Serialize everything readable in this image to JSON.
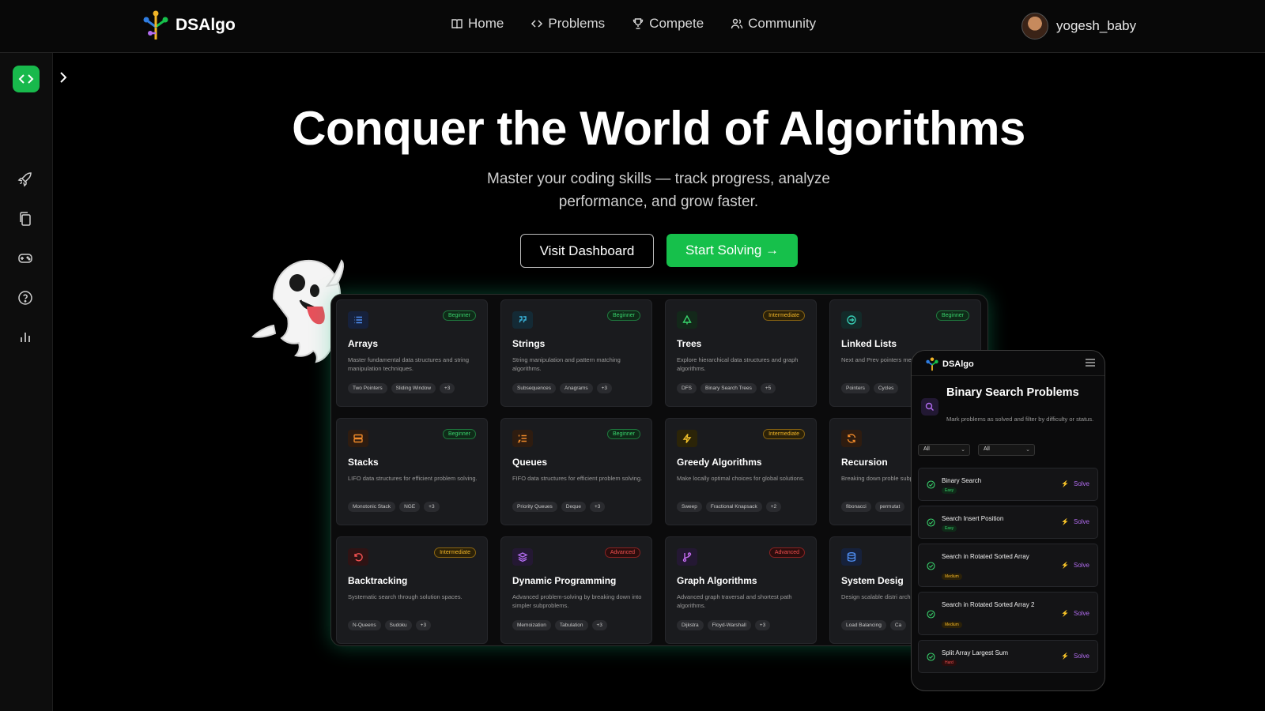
{
  "brand": {
    "name": "DSAlgo"
  },
  "nav": {
    "items": [
      {
        "label": "Home",
        "icon": "book-icon"
      },
      {
        "label": "Problems",
        "icon": "code-icon"
      },
      {
        "label": "Compete",
        "icon": "trophy-icon"
      },
      {
        "label": "Community",
        "icon": "users-icon"
      }
    ]
  },
  "user": {
    "name": "yogesh_baby"
  },
  "sidebar": {
    "icons": [
      "code-icon",
      "chevron-right-icon",
      "rocket-icon",
      "copy-icon",
      "gamepad-icon",
      "help-circle-icon",
      "bar-chart-icon"
    ]
  },
  "hero": {
    "title": "Conquer the World of Algorithms",
    "subtitle": "Master your coding skills — track progress, analyze performance, and grow faster.",
    "dashboard_button": "Visit Dashboard",
    "start_button": "Start Solving →"
  },
  "topics": [
    {
      "title": "Arrays",
      "level": "Beginner",
      "desc": "Master fundamental data structures and string manipulation techniques.",
      "tags": [
        "Two Pointers",
        "Sliding Window",
        "+3"
      ],
      "icon": "list-icon"
    },
    {
      "title": "Strings",
      "level": "Beginner",
      "desc": "String manipulation and pattern matching algorithms.",
      "tags": [
        "Subsequences",
        "Anagrams",
        "+3"
      ],
      "icon": "quote-icon"
    },
    {
      "title": "Trees",
      "level": "Intermediate",
      "desc": "Explore hierarchical data structures and graph algorithms.",
      "tags": [
        "DFS",
        "Binary Search Trees",
        "+5"
      ],
      "icon": "tree-icon"
    },
    {
      "title": "Linked Lists",
      "level": "Beginner",
      "desc": "Next and Prev pointers merging techniques.",
      "tags": [
        "Pointers",
        "Cycles"
      ],
      "icon": "arrow-circle-icon"
    },
    {
      "title": "Stacks",
      "level": "Beginner",
      "desc": "LIFO data structures for efficient problem solving.",
      "tags": [
        "Monotonic Stack",
        "NGE",
        "+3"
      ],
      "icon": "stack-icon"
    },
    {
      "title": "Queues",
      "level": "Beginner",
      "desc": "FIFO data structures for efficient problem solving.",
      "tags": [
        "Priority Queues",
        "Deque",
        "+3"
      ],
      "icon": "list-ordered-icon"
    },
    {
      "title": "Greedy Algorithms",
      "level": "Intermediate",
      "desc": "Make locally optimal choices for global solutions.",
      "tags": [
        "Sweep",
        "Fractional Knapsack",
        "+2"
      ],
      "icon": "zap-icon"
    },
    {
      "title": "Recursion",
      "level": "",
      "desc": "Breaking down proble subproblems.",
      "tags": [
        "fibonacci",
        "permutat"
      ],
      "icon": "refresh-icon"
    },
    {
      "title": "Backtracking",
      "level": "Intermediate",
      "desc": "Systematic search through solution spaces.",
      "tags": [
        "N-Queens",
        "Sudoku",
        "+3"
      ],
      "icon": "undo-icon"
    },
    {
      "title": "Dynamic Programming",
      "level": "Advanced",
      "desc": "Advanced problem-solving by breaking down into simpler subproblems.",
      "tags": [
        "Memoization",
        "Tabulation",
        "+3"
      ],
      "icon": "layers-icon"
    },
    {
      "title": "Graph Algorithms",
      "level": "Advanced",
      "desc": "Advanced graph traversal and shortest path algorithms.",
      "tags": [
        "Dijkstra",
        "Floyd-Warshall",
        "+3"
      ],
      "icon": "git-branch-icon"
    },
    {
      "title": "System Desig",
      "level": "",
      "desc": "Design scalable distri architectures.",
      "tags": [
        "Load Balancing",
        "Ca"
      ],
      "icon": "database-icon"
    }
  ],
  "colors": {
    "accent": "#16c04b",
    "beginner": "#38d26b",
    "intermediate": "#f2b527",
    "advanced": "#f05050",
    "solve": "#b26cf0"
  },
  "phone": {
    "brand": "DSAlgo",
    "title": "Binary Search Problems",
    "desc": "Mark problems as solved and filter by difficulty or status.",
    "filter1": "All",
    "filter2": "All",
    "problems": [
      {
        "name": "Binary Search",
        "difficulty": "Easy",
        "action": "Solve"
      },
      {
        "name": "Search Insert Position",
        "difficulty": "Easy",
        "action": "Solve"
      },
      {
        "name": "Search in Rotated Sorted Array",
        "difficulty": "Medium",
        "action": "Solve"
      },
      {
        "name": "Search in Rotated Sorted Array 2",
        "difficulty": "Medium",
        "action": "Solve"
      },
      {
        "name": "Split Array Largest Sum",
        "difficulty": "Hard",
        "action": "Solve"
      }
    ]
  }
}
